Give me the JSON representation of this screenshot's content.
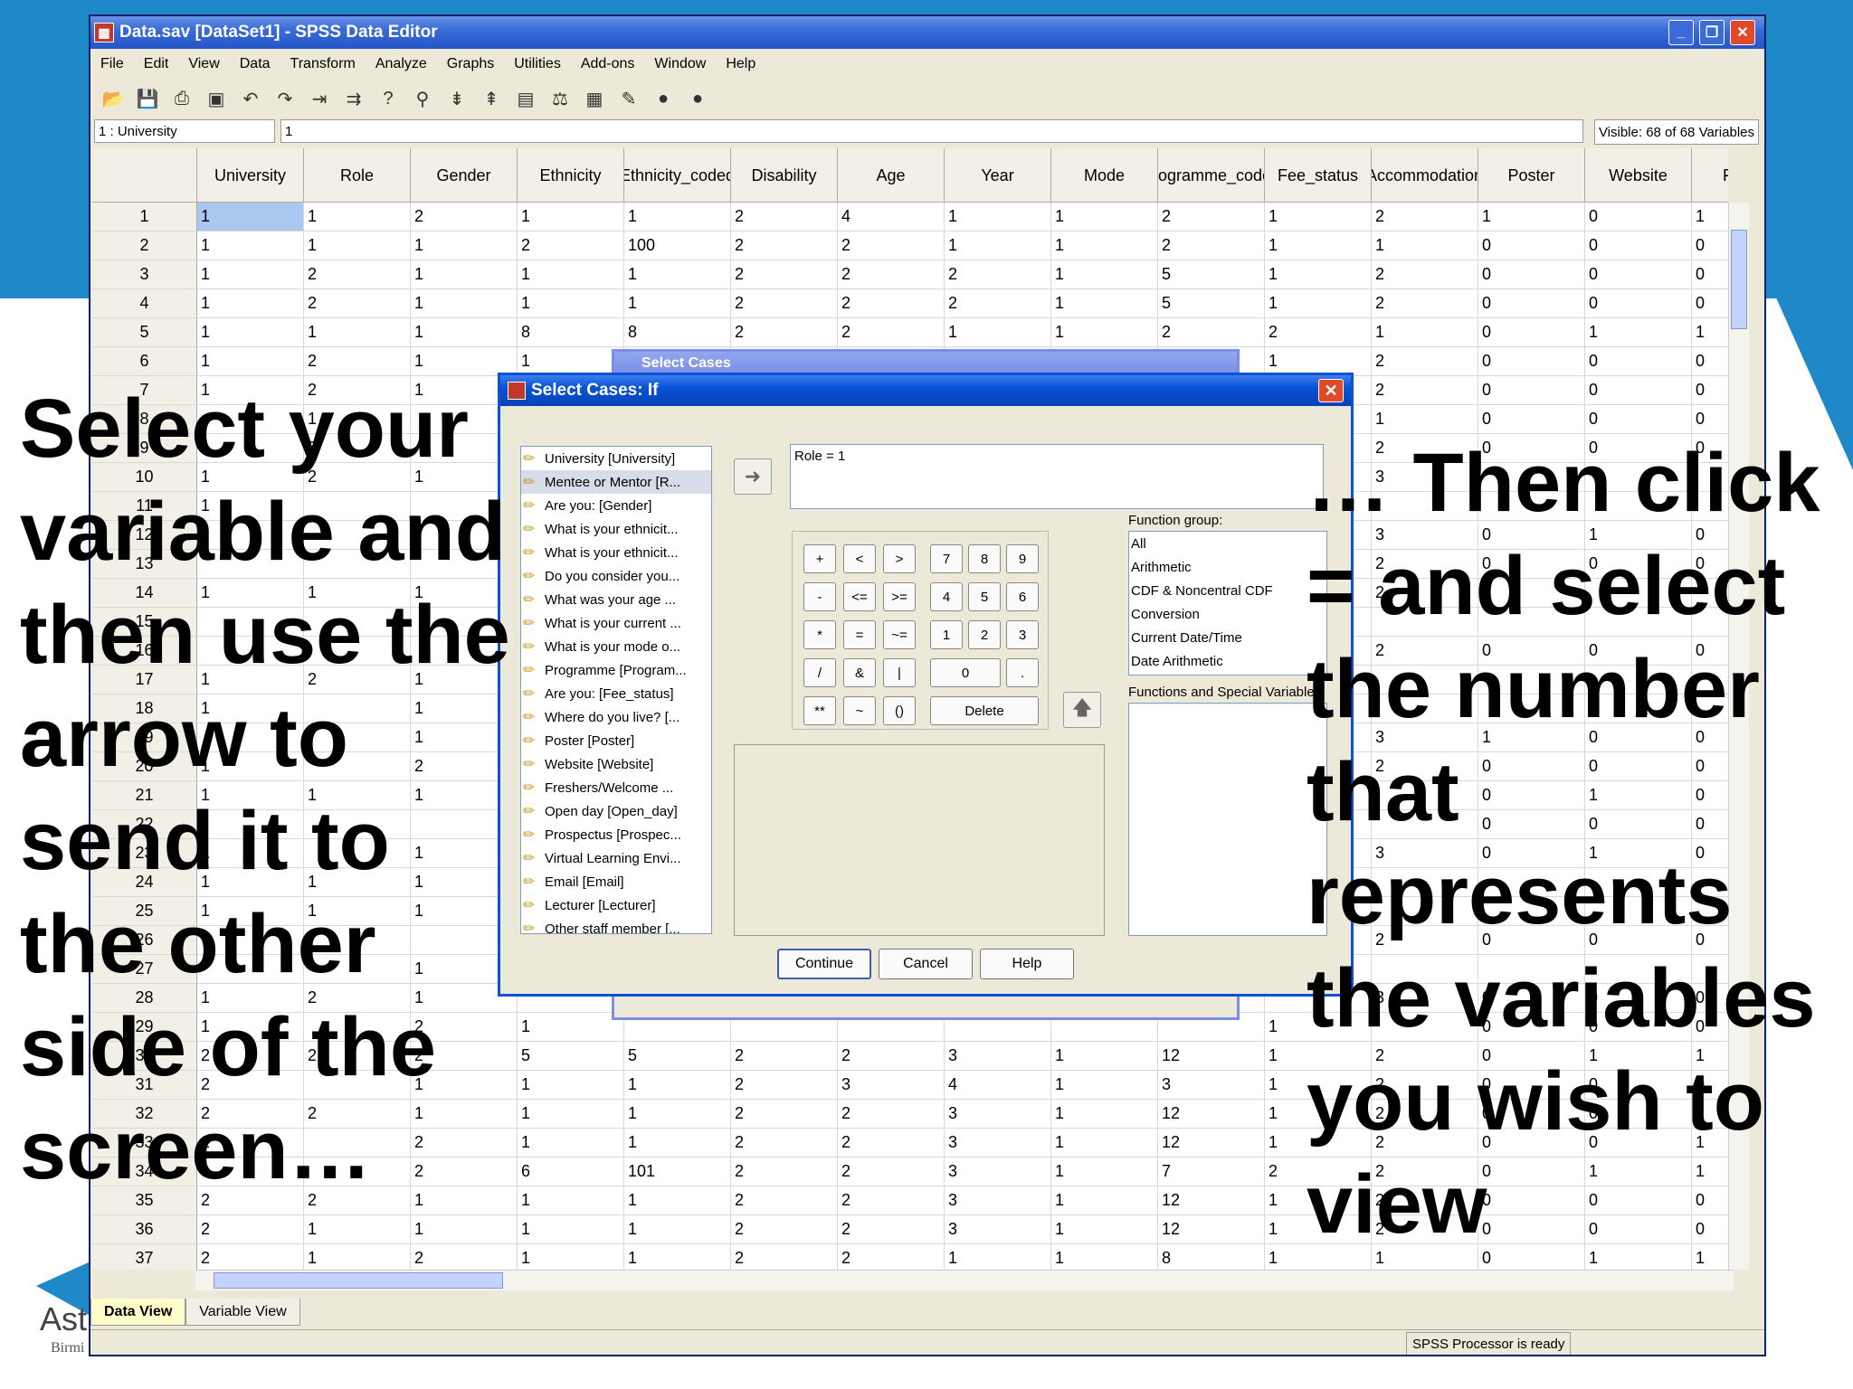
{
  "window": {
    "title": "Data.sav [DataSet1] - SPSS Data Editor",
    "controls": [
      "_",
      "❐",
      "✕"
    ]
  },
  "menu": [
    "File",
    "Edit",
    "View",
    "Data",
    "Transform",
    "Analyze",
    "Graphs",
    "Utilities",
    "Add-ons",
    "Window",
    "Help"
  ],
  "cell_editor": {
    "name": "1 : University",
    "value": "1",
    "visible": "Visible: 68 of 68 Variables"
  },
  "grid": {
    "columns": [
      {
        "label": "University"
      },
      {
        "label": "Role"
      },
      {
        "label": "Gender"
      },
      {
        "label": "Ethnicity"
      },
      {
        "label": "Ethnicity_coded"
      },
      {
        "label": "Disability"
      },
      {
        "label": "Age"
      },
      {
        "label": "Year"
      },
      {
        "label": "Mode"
      },
      {
        "label": "Programme_coded"
      },
      {
        "label": "Fee_status"
      },
      {
        "label": "Accommodation"
      },
      {
        "label": "Poster"
      },
      {
        "label": "Website"
      },
      {
        "label": "F"
      }
    ],
    "rows": [
      {
        "n": "1",
        "c": [
          "1",
          "1",
          "2",
          "1",
          "1",
          "2",
          "4",
          "1",
          "1",
          "2",
          "1",
          "2",
          "1",
          "0",
          "1"
        ]
      },
      {
        "n": "2",
        "c": [
          "1",
          "1",
          "1",
          "2",
          "100",
          "2",
          "2",
          "1",
          "1",
          "2",
          "1",
          "1",
          "0",
          "0",
          "0"
        ]
      },
      {
        "n": "3",
        "c": [
          "1",
          "2",
          "1",
          "1",
          "1",
          "2",
          "2",
          "2",
          "1",
          "5",
          "1",
          "2",
          "0",
          "0",
          "0"
        ]
      },
      {
        "n": "4",
        "c": [
          "1",
          "2",
          "1",
          "1",
          "1",
          "2",
          "2",
          "2",
          "1",
          "5",
          "1",
          "2",
          "0",
          "0",
          "0"
        ]
      },
      {
        "n": "5",
        "c": [
          "1",
          "1",
          "1",
          "8",
          "8",
          "2",
          "2",
          "1",
          "1",
          "2",
          "2",
          "1",
          "0",
          "1",
          "1"
        ]
      },
      {
        "n": "6",
        "c": [
          "1",
          "2",
          "1",
          "1",
          "",
          "",
          "",
          "",
          "",
          "",
          "1",
          "2",
          "0",
          "0",
          "0"
        ]
      },
      {
        "n": "7",
        "c": [
          "1",
          "2",
          "1",
          "",
          "",
          "",
          "",
          "",
          "",
          "",
          "",
          "2",
          "0",
          "0",
          "0"
        ]
      },
      {
        "n": "8",
        "c": [
          "",
          "1",
          "",
          "",
          "",
          "",
          "",
          "",
          "",
          "",
          "",
          "1",
          "0",
          "0",
          "0"
        ]
      },
      {
        "n": "9",
        "c": [
          "",
          "2",
          "",
          "",
          "",
          "",
          "",
          "",
          "",
          "",
          "",
          "2",
          "0",
          "0",
          "0"
        ]
      },
      {
        "n": "10",
        "c": [
          "1",
          "2",
          "1",
          "",
          "",
          "",
          "",
          "",
          "",
          "",
          "",
          "3",
          "",
          "",
          ""
        ]
      },
      {
        "n": "11",
        "c": [
          "1",
          "",
          "",
          "",
          "",
          "",
          "",
          "",
          "",
          "",
          "",
          "",
          "",
          "",
          ""
        ]
      },
      {
        "n": "12",
        "c": [
          "",
          "",
          "",
          "",
          "",
          "",
          "",
          "",
          "",
          "",
          "",
          "3",
          "0",
          "1",
          "0"
        ]
      },
      {
        "n": "13",
        "c": [
          "",
          "",
          "",
          "",
          "",
          "",
          "",
          "",
          "",
          "",
          "",
          "2",
          "0",
          "0",
          "0"
        ]
      },
      {
        "n": "14",
        "c": [
          "1",
          "1",
          "1",
          "",
          "",
          "",
          "",
          "",
          "",
          "",
          "",
          "2",
          "",
          "",
          ""
        ]
      },
      {
        "n": "15",
        "c": [
          "",
          "",
          "",
          "",
          "",
          "",
          "",
          "",
          "",
          "",
          "",
          "",
          "",
          "",
          ""
        ]
      },
      {
        "n": "16",
        "c": [
          "",
          "",
          "",
          "",
          "",
          "",
          "",
          "",
          "",
          "",
          "",
          "2",
          "0",
          "0",
          "0"
        ]
      },
      {
        "n": "17",
        "c": [
          "1",
          "2",
          "1",
          "",
          "",
          "",
          "",
          "",
          "",
          "",
          "",
          "",
          "",
          "",
          ""
        ]
      },
      {
        "n": "18",
        "c": [
          "1",
          "",
          "1",
          "",
          "",
          "",
          "",
          "",
          "",
          "",
          "",
          "",
          "",
          "",
          ""
        ]
      },
      {
        "n": "19",
        "c": [
          "",
          "",
          "1",
          "",
          "",
          "",
          "",
          "",
          "",
          "",
          "",
          "3",
          "1",
          "0",
          "0"
        ]
      },
      {
        "n": "20",
        "c": [
          "1",
          "",
          "2",
          "",
          "",
          "",
          "",
          "",
          "",
          "",
          "",
          "2",
          "0",
          "0",
          "0"
        ]
      },
      {
        "n": "21",
        "c": [
          "1",
          "1",
          "1",
          "",
          "",
          "",
          "",
          "",
          "",
          "",
          "",
          "",
          "0",
          "1",
          "0"
        ]
      },
      {
        "n": "22",
        "c": [
          "",
          "",
          "",
          "",
          "",
          "",
          "",
          "",
          "",
          "",
          "",
          "",
          "0",
          "0",
          "0"
        ]
      },
      {
        "n": "23",
        "c": [
          "1",
          "",
          "1",
          "",
          "",
          "",
          "",
          "",
          "",
          "",
          "",
          "3",
          "0",
          "1",
          "0"
        ]
      },
      {
        "n": "24",
        "c": [
          "1",
          "1",
          "1",
          "",
          "",
          "",
          "",
          "",
          "",
          "",
          "",
          "",
          "",
          "",
          ""
        ]
      },
      {
        "n": "25",
        "c": [
          "1",
          "1",
          "1",
          "",
          "",
          "",
          "",
          "",
          "",
          "",
          "",
          "",
          "",
          "",
          ""
        ]
      },
      {
        "n": "26",
        "c": [
          "",
          "",
          "",
          "",
          "",
          "",
          "",
          "",
          "",
          "",
          "",
          "2",
          "0",
          "0",
          "0"
        ]
      },
      {
        "n": "27",
        "c": [
          "",
          "",
          "1",
          "",
          "",
          "",
          "",
          "",
          "",
          "",
          "",
          "",
          "",
          "",
          ""
        ]
      },
      {
        "n": "28",
        "c": [
          "1",
          "2",
          "1",
          "",
          "",
          "",
          "",
          "",
          "",
          "",
          "",
          "3",
          "0",
          "0",
          "0"
        ]
      },
      {
        "n": "29",
        "c": [
          "1",
          "",
          "2",
          "1",
          "",
          "",
          "",
          "",
          "",
          "",
          "1",
          "",
          "0",
          "0",
          "0"
        ]
      },
      {
        "n": "30",
        "c": [
          "2",
          "2",
          "2",
          "5",
          "5",
          "2",
          "2",
          "3",
          "1",
          "12",
          "1",
          "2",
          "0",
          "1",
          "1"
        ]
      },
      {
        "n": "31",
        "c": [
          "2",
          "",
          "1",
          "1",
          "1",
          "2",
          "3",
          "4",
          "1",
          "3",
          "1",
          "2",
          "0",
          "0",
          "0"
        ]
      },
      {
        "n": "32",
        "c": [
          "2",
          "2",
          "1",
          "1",
          "1",
          "2",
          "2",
          "3",
          "1",
          "12",
          "1",
          "2",
          "0",
          "0",
          "1"
        ]
      },
      {
        "n": "33",
        "c": [
          "2",
          "",
          "2",
          "1",
          "1",
          "2",
          "2",
          "3",
          "1",
          "12",
          "1",
          "2",
          "0",
          "0",
          "1"
        ]
      },
      {
        "n": "34",
        "c": [
          "",
          "",
          "2",
          "6",
          "101",
          "2",
          "2",
          "3",
          "1",
          "7",
          "2",
          "2",
          "0",
          "1",
          "1"
        ]
      },
      {
        "n": "35",
        "c": [
          "2",
          "2",
          "1",
          "1",
          "1",
          "2",
          "2",
          "3",
          "1",
          "12",
          "1",
          "2",
          "0",
          "0",
          "0"
        ]
      },
      {
        "n": "36",
        "c": [
          "2",
          "1",
          "1",
          "1",
          "1",
          "2",
          "2",
          "3",
          "1",
          "12",
          "1",
          "2",
          "0",
          "0",
          "0"
        ]
      },
      {
        "n": "37",
        "c": [
          "2",
          "1",
          "2",
          "1",
          "1",
          "2",
          "2",
          "1",
          "1",
          "8",
          "1",
          "1",
          "0",
          "1",
          "1"
        ]
      }
    ]
  },
  "tabs": [
    "Data View",
    "Variable View"
  ],
  "status": "SPSS  Processor is ready",
  "back_dialog": {
    "title": "Select Cases"
  },
  "dialog": {
    "title": "Select Cases: If",
    "variables": [
      "University [University]",
      "Mentee or Mentor [R...",
      "Are you: [Gender]",
      "What is your ethnicit...",
      "What is your ethnicit...",
      "Do you consider you...",
      "What was your age ...",
      "What is your current ...",
      "What is your mode o...",
      "Programme [Program...",
      "Are you: [Fee_status]",
      "Where do you live? [...",
      "Poster [Poster]",
      "Website [Website]",
      "Freshers/Welcome ...",
      "Open day [Open_day]",
      "Prospectus [Prospec...",
      "Virtual Learning Envi...",
      "Email [Email]",
      "Lecturer [Lecturer]",
      "Other staff member [..."
    ],
    "expression": "Role = 1",
    "calc_keys": [
      "+",
      "<",
      ">",
      "7",
      "8",
      "9",
      "-",
      "<=",
      ">=",
      "4",
      "5",
      "6",
      "*",
      "=",
      "~=",
      "1",
      "2",
      "3",
      "/",
      "&",
      "|",
      "0",
      ".",
      "**",
      "~",
      "()",
      "Delete"
    ],
    "function_group_label": "Function group:",
    "function_groups": [
      "All",
      "Arithmetic",
      "CDF & Noncentral CDF",
      "Conversion",
      "Current Date/Time",
      "Date Arithmetic"
    ],
    "functions_label": "Functions and Special Variables:",
    "buttons": {
      "continue": "Continue",
      "cancel": "Cancel",
      "help": "Help"
    }
  },
  "captions": {
    "left": [
      "Select your",
      "variable and",
      "then use the",
      "arrow to",
      "send it to",
      "the other",
      "side of the",
      "screen…"
    ],
    "right": [
      "… Then click",
      "= and select",
      "the number",
      "that",
      "represents",
      "the variables",
      "you wish to",
      "view"
    ]
  },
  "logo": {
    "name": "Ast",
    "sub": "Birmi"
  }
}
